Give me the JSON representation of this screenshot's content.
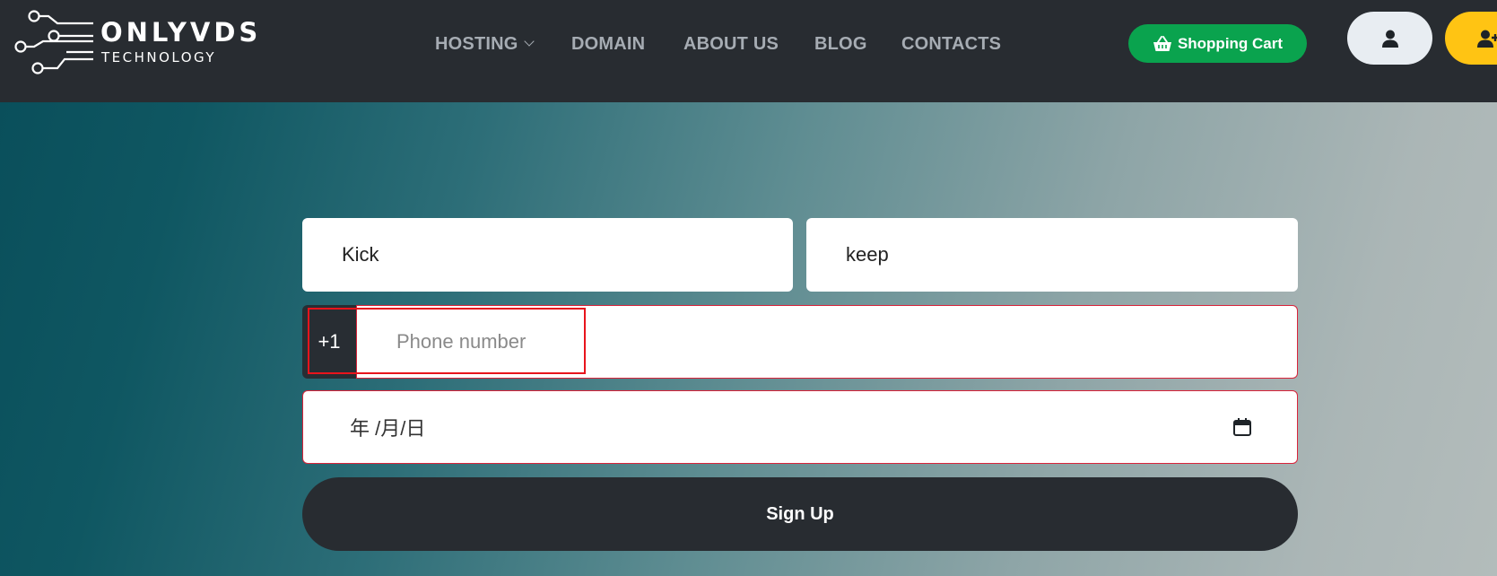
{
  "brand": {
    "name": "ONLYVDS",
    "tagline": "TECHNOLOGY"
  },
  "nav": {
    "items": [
      {
        "label": "HOSTING",
        "has_dropdown": true
      },
      {
        "label": "DOMAIN"
      },
      {
        "label": "ABOUT US"
      },
      {
        "label": "BLOG"
      },
      {
        "label": "CONTACTS"
      }
    ]
  },
  "header_actions": {
    "cart_label": "Shopping Cart",
    "cart_icon": "basket-icon",
    "account_icon": "user-icon",
    "signup_icon": "user-plus-icon"
  },
  "form": {
    "first_name_value": "Kick",
    "last_name_value": "keep",
    "phone_prefix": "+1",
    "phone_placeholder": "Phone number",
    "dob_placeholder": "年 /月/日",
    "submit_label": "Sign Up"
  },
  "colors": {
    "header_bg": "#282c31",
    "cart_green": "#0aa34e",
    "signup_yellow": "#ffc413",
    "error_red": "#d9233a"
  }
}
